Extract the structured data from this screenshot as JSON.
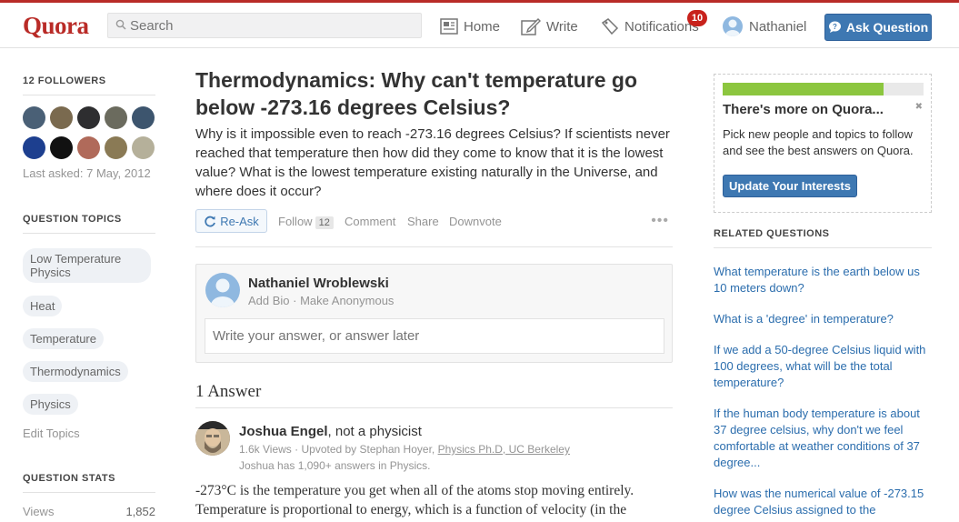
{
  "header": {
    "logo": "Quora",
    "search_placeholder": "Search",
    "nav": {
      "home": "Home",
      "write": "Write",
      "notifications": "Notifications",
      "notifications_count": "10",
      "user": "Nathaniel"
    },
    "ask_button": "Ask Question"
  },
  "left": {
    "followers_title": "12 FOLLOWERS",
    "last_asked": "Last asked: 7 May, 2012",
    "topics_title": "QUESTION TOPICS",
    "topics": [
      "Low Temperature Physics",
      "Heat",
      "Temperature",
      "Thermodynamics",
      "Physics"
    ],
    "edit_topics": "Edit Topics",
    "stats_title": "QUESTION STATS",
    "views_label": "Views",
    "views_value": "1,852"
  },
  "question": {
    "title": "Thermodynamics: Why can't temperature go below -273.16 degrees Celsius?",
    "detail": "Why is it impossible even to reach -273.16 degrees Celsius? If scientists never reached that temperature then how did they come to know that it is the lowest value? What is the lowest temperature existing naturally in the Universe, and where does it occur?",
    "actions": {
      "reask": "Re-Ask",
      "follow": "Follow",
      "follow_count": "12",
      "comment": "Comment",
      "share": "Share",
      "downvote": "Downvote",
      "more": "•••"
    }
  },
  "composer": {
    "name": "Nathaniel Wroblewski",
    "sub": "Add Bio · Make Anonymous",
    "placeholder": "Write your answer, or answer later"
  },
  "answers": {
    "count_label": "1 Answer",
    "items": [
      {
        "author": "Joshua Engel",
        "credential": ", not a physicist",
        "meta_prefix": "1.6k Views · Upvoted by Stephan Hoyer, ",
        "meta_link": "Physics Ph.D, UC Berkeley",
        "meta2": "Joshua has 1,090+ answers in Physics.",
        "body": "-273°C is the temperature you get when all of the atoms stop moving entirely. Temperature is proportional to energy, which is a function of velocity (in the"
      }
    ]
  },
  "right": {
    "promo_title": "There's more on Quora...",
    "promo_close": "✖",
    "promo_text": "Pick new people and topics to follow and see the best answers on Quora.",
    "promo_progress": 0.8,
    "promo_button": "Update Your Interests",
    "related_title": "RELATED QUESTIONS",
    "related": [
      "What temperature is the earth below us 10 meters down?",
      "What is a 'degree' in temperature?",
      "If we add a 50-degree Celsius liquid with 100 degrees, what will be the total temperature?",
      "If the human body temperature is about 37 degree celsius, why don't we feel comfortable at weather conditions of 37 degree...",
      "How was the numerical value of -273.15 degree Celsius assigned to the"
    ]
  },
  "colors": {
    "brand": "#b92b27",
    "link": "#2b6dad",
    "button": "#3e78b2",
    "progress": "#8cc63f"
  }
}
